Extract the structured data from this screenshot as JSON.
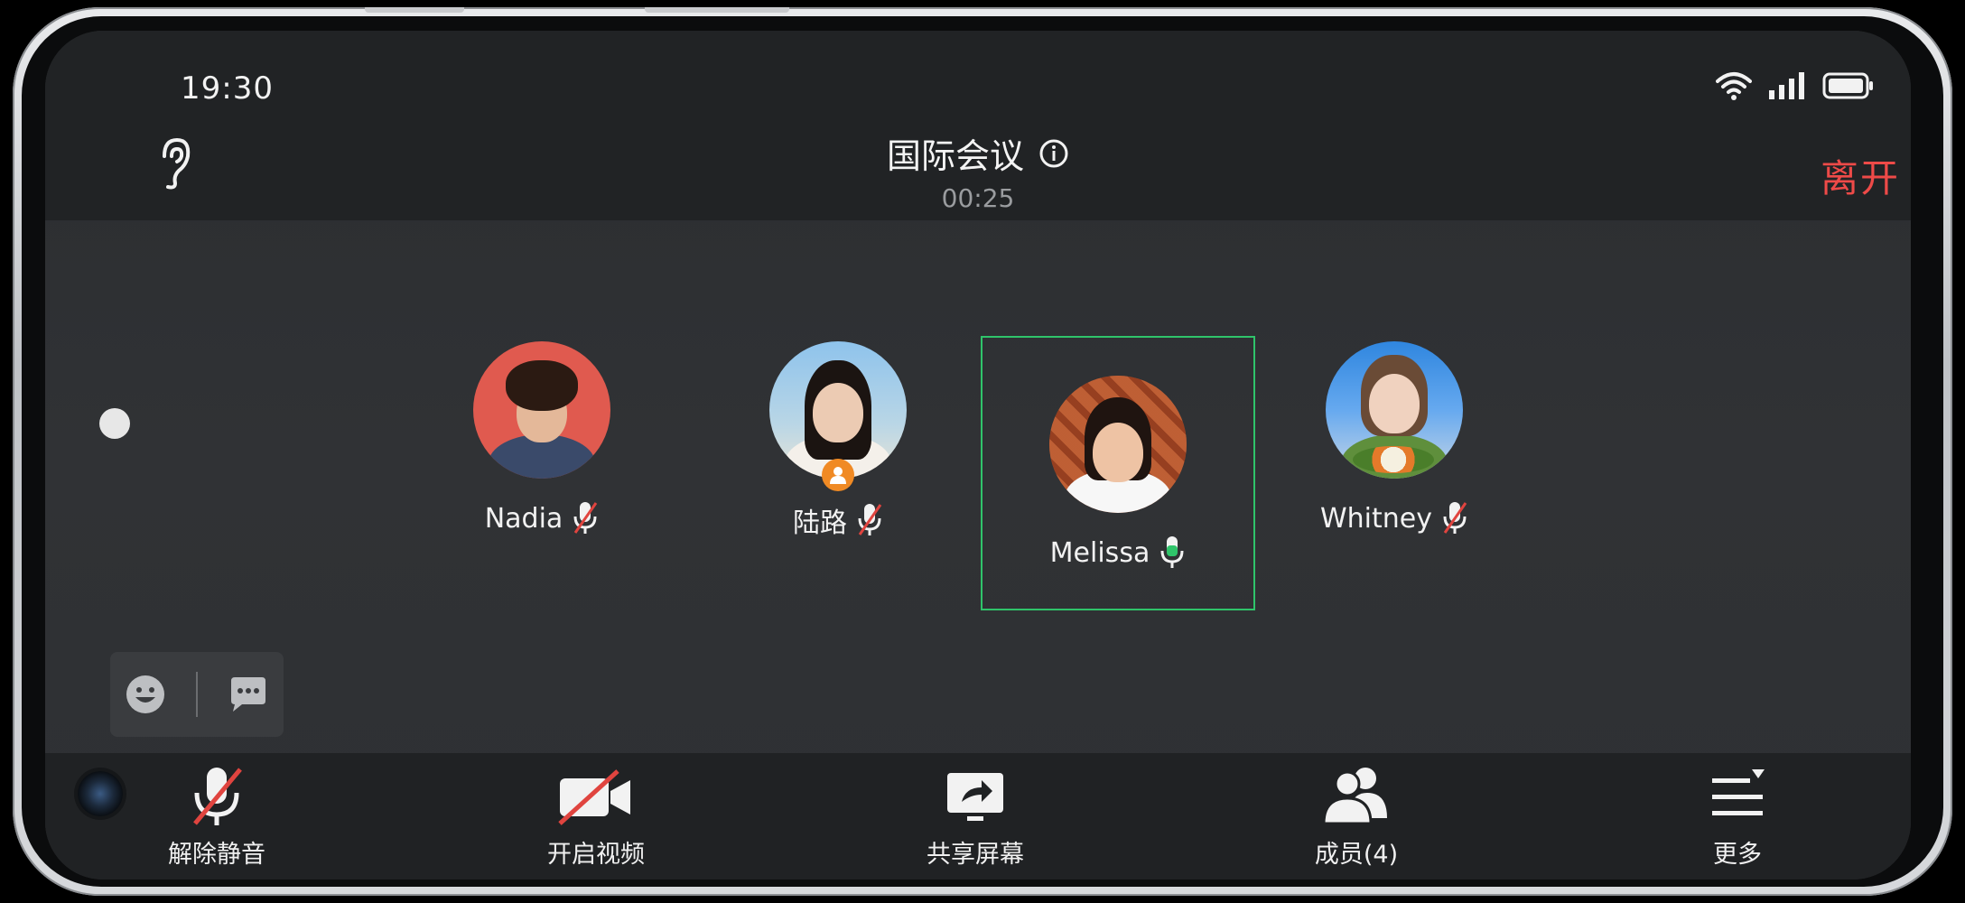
{
  "status_bar": {
    "time": "19:30"
  },
  "header": {
    "meeting_title": "国际会议",
    "timer": "00:25",
    "leave_label": "离开"
  },
  "participants": [
    {
      "name": "Nadia",
      "mic": "muted",
      "speaking": false,
      "host": false,
      "avatar_bg": "#e05a4f"
    },
    {
      "name": "陆路",
      "mic": "muted",
      "speaking": false,
      "host": true,
      "avatar_bg": "#7fb2d9"
    },
    {
      "name": "Melissa",
      "mic": "on",
      "speaking": true,
      "host": false,
      "avatar_bg": "#b9542f"
    },
    {
      "name": "Whitney",
      "mic": "muted",
      "speaking": false,
      "host": false,
      "avatar_bg": "#3c8fe0"
    }
  ],
  "toolbar": {
    "unmute_label": "解除静音",
    "video_label": "开启视频",
    "share_label": "共享屏幕",
    "members_label": "成员(4)",
    "more_label": "更多"
  },
  "colors": {
    "leave_red": "#ee4a48",
    "active_green": "#2fc46a",
    "muted_red": "#e0443f",
    "host_orange": "#f08a24"
  },
  "icons": {
    "ear": "ear-icon",
    "info": "info-icon",
    "emoji": "emoji-icon",
    "chat": "chat-icon",
    "mic_off": "mic-off-icon",
    "mic_on": "mic-on-icon",
    "video_off": "video-off-icon",
    "share": "share-screen-icon",
    "members": "members-icon",
    "more": "more-icon"
  }
}
